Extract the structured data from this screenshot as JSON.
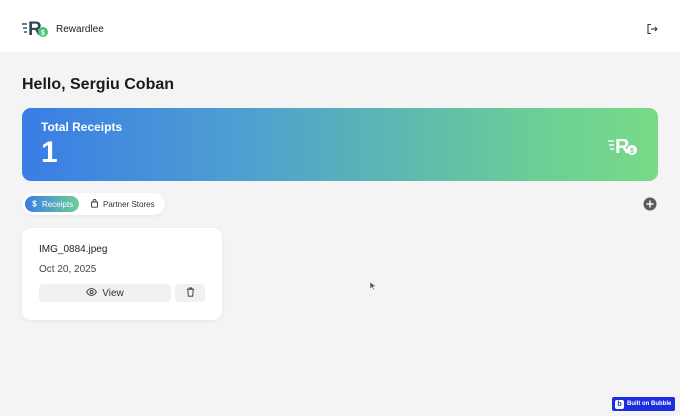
{
  "header": {
    "brand_name": "Rewardlee",
    "logo_icon": "rewardlee-logo-icon",
    "logout_icon": "logout-icon"
  },
  "greeting": "Hello, Sergiu Coban",
  "summary": {
    "title": "Total Receipts",
    "count": "1",
    "logo_icon": "rewardlee-logo-icon"
  },
  "tabs": [
    {
      "label": "Receipts",
      "icon": "dollar-icon",
      "active": true
    },
    {
      "label": "Partner Stores",
      "icon": "shopping-bag-icon",
      "active": false
    }
  ],
  "add_icon": "plus-circle-icon",
  "receipts": [
    {
      "file_name": "IMG_0884.jpeg",
      "date": "Oct 20, 2025",
      "view_label": "View",
      "view_icon": "eye-icon",
      "delete_icon": "trash-icon"
    }
  ],
  "footer_badge": {
    "label": "Built on Bubble",
    "letter": "b"
  },
  "colors": {
    "background": "#f4f4f4",
    "gradient_start": "#3a7de6",
    "gradient_end": "#78da86",
    "brand_green": "#4cc37a",
    "bubble_blue": "#1b2ee0"
  }
}
